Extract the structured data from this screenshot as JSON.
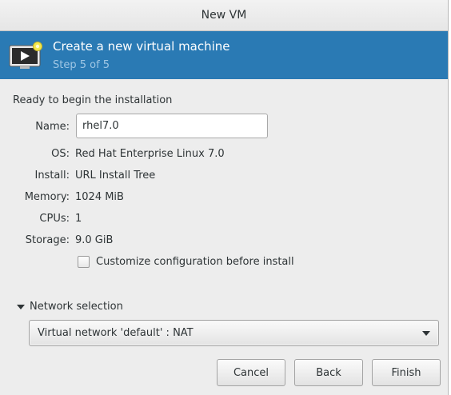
{
  "window": {
    "title": "New VM"
  },
  "banner": {
    "title": "Create a new virtual machine",
    "step": "Step 5 of 5",
    "icon": "vm-monitor-icon",
    "color": "#2a7ab4"
  },
  "summary": {
    "heading": "Ready to begin the installation",
    "name_label": "Name:",
    "name_value": "rhel7.0",
    "os_label": "OS:",
    "os_value": "Red Hat Enterprise Linux 7.0",
    "install_label": "Install:",
    "install_value": "URL Install Tree",
    "memory_label": "Memory:",
    "memory_value": "1024 MiB",
    "cpus_label": "CPUs:",
    "cpus_value": "1",
    "storage_label": "Storage:",
    "storage_value": "9.0 GiB",
    "customize_label": "Customize configuration before install",
    "customize_checked": false
  },
  "network": {
    "expander_label": "Network selection",
    "expanded": true,
    "selected": "Virtual network 'default' : NAT"
  },
  "buttons": {
    "cancel": "Cancel",
    "back": "Back",
    "finish": "Finish"
  }
}
